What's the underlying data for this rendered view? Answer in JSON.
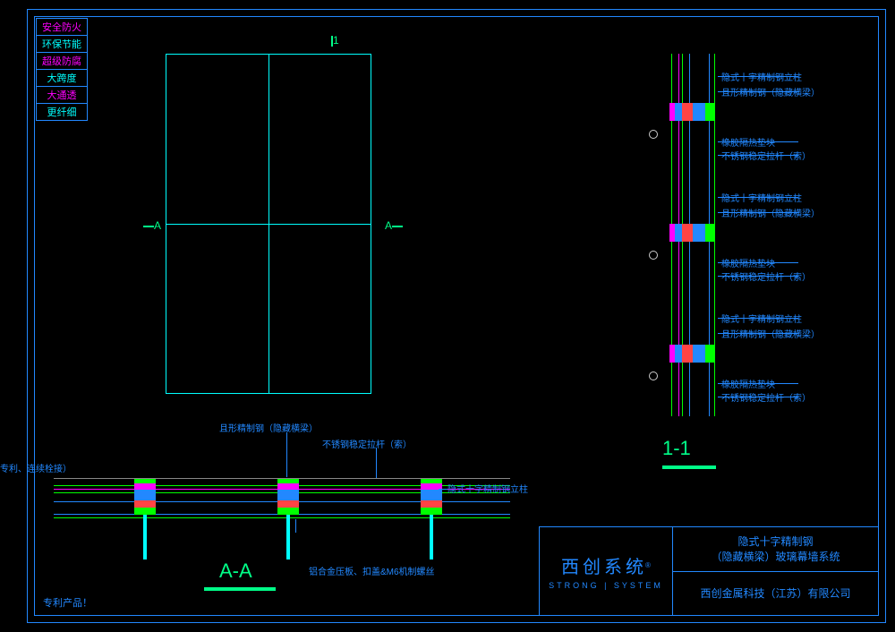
{
  "features": [
    "安全防火",
    "环保节能",
    "超级防腐",
    "大跨度",
    "大通透",
    "更纤细"
  ],
  "feature_colors": [
    "mag",
    "cyan",
    "mag",
    "cyan",
    "mag",
    "cyan"
  ],
  "section_marks": {
    "top": "1",
    "left": "A",
    "right": "A"
  },
  "detail_labels": {
    "a": "隐式十字精制钢立柱",
    "b": "且形精制钢（隐藏横梁）",
    "c": "橡胶隔热垫块",
    "d": "不锈钢稳定拉杆（索）"
  },
  "section11": "1-1",
  "aa_labels": {
    "patent": "西创系统：公母螺栓（专利、连续栓接）",
    "beam": "且形精制钢（隐藏横梁）",
    "rod": "不锈钢稳定拉杆（索）",
    "column": "隐式十字精制钢立柱",
    "plate": "铝合金压板、扣盖&M6机制螺丝"
  },
  "sectionAA": "A-A",
  "patent_note": "专利产品！",
  "title_block": {
    "brand_cn": "西创系统",
    "brand_en": "STRONG | SYSTEM",
    "title_line1": "隐式十字精制钢",
    "title_line2": "（隐藏横梁）玻璃幕墙系统",
    "company": "西创金属科技（江苏）有限公司"
  }
}
